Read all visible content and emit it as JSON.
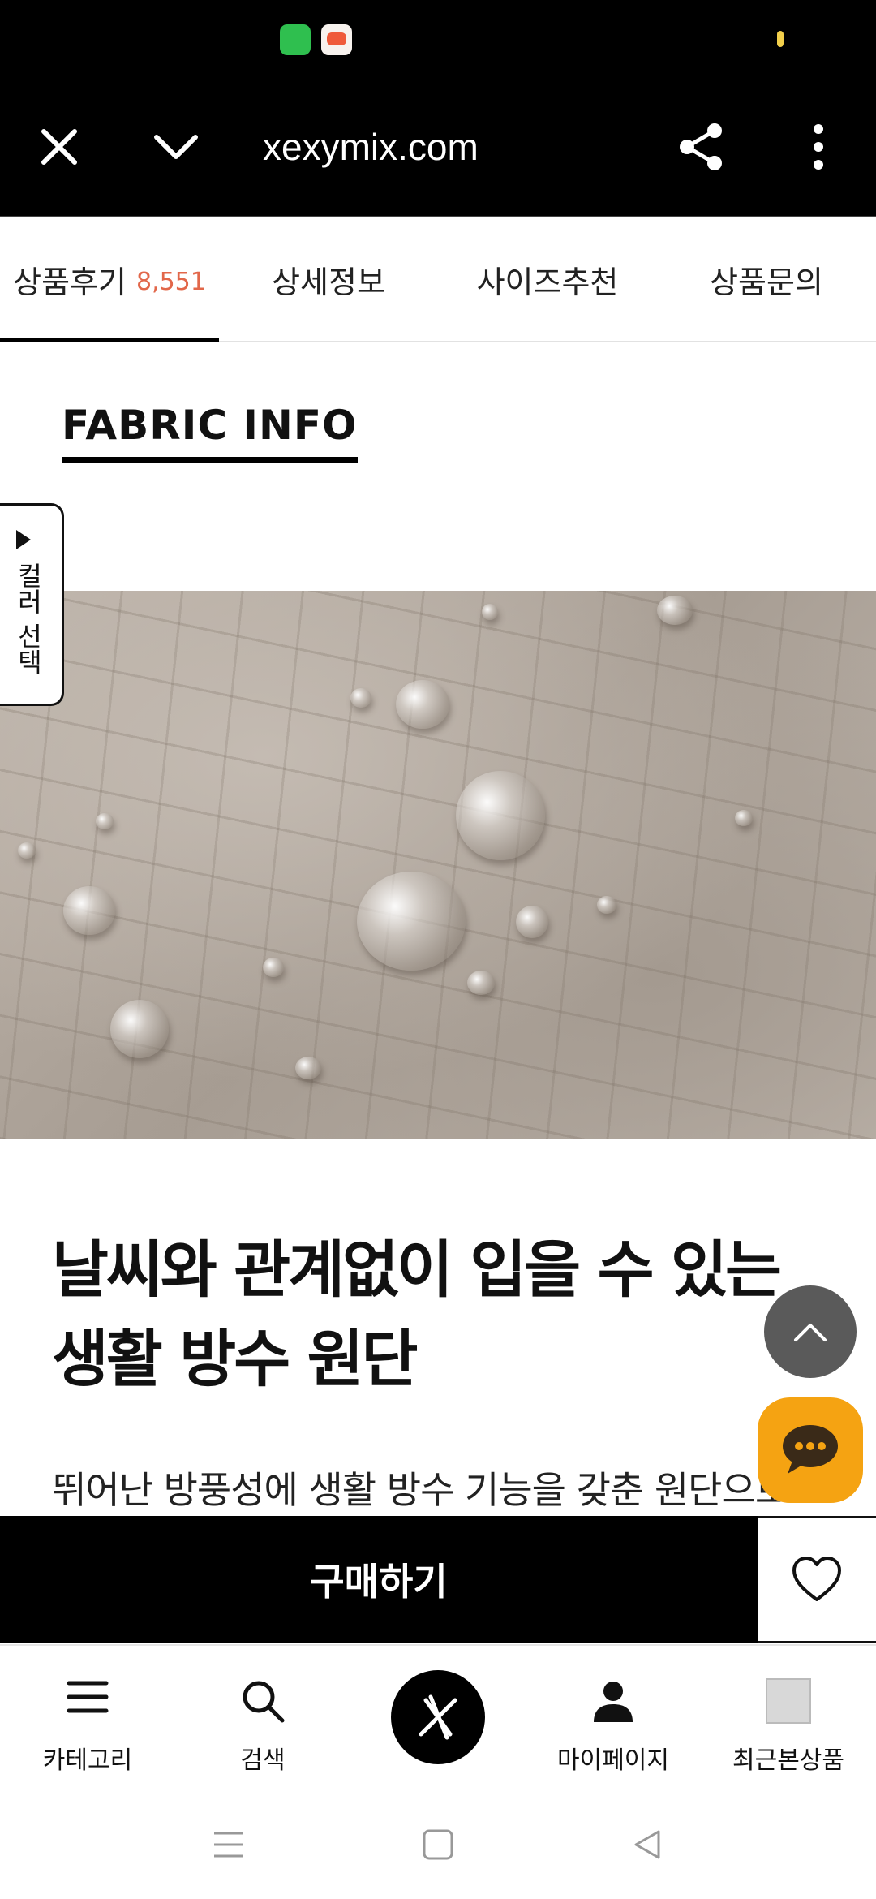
{
  "browser": {
    "url": "xexymix.com"
  },
  "tabs": [
    {
      "label": "상품후기",
      "count": "8,551"
    },
    {
      "label": "상세정보"
    },
    {
      "label": "사이즈추천"
    },
    {
      "label": "상품문의"
    }
  ],
  "section": {
    "title": "FABRIC INFO"
  },
  "color_select": {
    "label": "컬러 선택"
  },
  "content": {
    "headline_line1": "날씨와 관계없이 입을 수 있는",
    "headline_line2": "생활 방수 원단",
    "body": "뛰어난 방풍성에 생활 방수 기능을 갖춘 원단으로"
  },
  "purchase": {
    "buy_label": "구매하기"
  },
  "bottom_nav": {
    "category": "카테고리",
    "search": "검색",
    "mypage": "마이페이지",
    "recent": "최근본상품"
  },
  "colors": {
    "accent_count": "#e2674a",
    "chat_button": "#f5a312",
    "scroll_button": "#5a5a5a"
  }
}
